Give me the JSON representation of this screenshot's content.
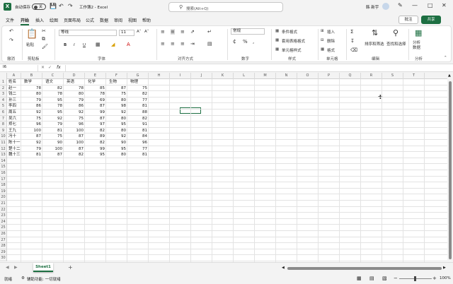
{
  "titlebar": {
    "logo": "X",
    "autosave_label": "自动保存",
    "autosave_state": "关",
    "title": "工作簿2 - Excel",
    "search_placeholder": "搜索(Alt+Q)",
    "user": "韩 新宇",
    "icons": [
      "excel-icon",
      "save-icon",
      "undo-icon",
      "redo-icon",
      "search-icon",
      "pen-icon",
      "minimize-icon",
      "maximize-icon",
      "close-icon"
    ]
  },
  "menu": {
    "items": [
      "文件",
      "开始",
      "插入",
      "绘图",
      "页面布局",
      "公式",
      "数据",
      "审阅",
      "视图",
      "帮助"
    ],
    "active": "开始",
    "comment_label": "批注",
    "share_label": "共享"
  },
  "ribbon": {
    "groups": [
      "撤消",
      "剪贴板",
      "字体",
      "对齐方式",
      "数字",
      "样式",
      "单元格",
      "编辑",
      "分析"
    ],
    "paste_label": "粘贴",
    "font_name": "等线",
    "font_size": "11",
    "number_format": "常规",
    "cond_format": "条件格式",
    "table_format": "套用表格格式",
    "cell_styles": "单元格样式",
    "insert": "插入",
    "delete": "删除",
    "format": "格式",
    "sort_filter": "排序和筛选",
    "find_select": "查找和选择",
    "analyze": "分析\n数据",
    "bold": "B",
    "italic": "I",
    "underline": "U"
  },
  "formula_bar": {
    "name_box": "I6",
    "fx": "fx",
    "content": ""
  },
  "sheet": {
    "columns": [
      "A",
      "B",
      "C",
      "D",
      "E",
      "F",
      "G",
      "H",
      "I",
      "J",
      "K",
      "L",
      "M",
      "N",
      "O",
      "P",
      "Q",
      "R",
      "S",
      "T"
    ],
    "row_numbers": [
      "1",
      "2",
      "3",
      "4",
      "5",
      "6",
      "7",
      "8",
      "9",
      "10",
      "11",
      "12",
      "13",
      "14",
      "15",
      "16",
      "17",
      "18",
      "19",
      "20",
      "21",
      "22",
      "23",
      "24",
      "25",
      "26",
      "27",
      "28",
      "29",
      "30"
    ],
    "rows": [
      [
        "姓名",
        "数学",
        "语文",
        "英语",
        "化学",
        "生物",
        "物理"
      ],
      [
        "赵一",
        "78",
        "82",
        "78",
        "85",
        "87",
        "75"
      ],
      [
        "钱二",
        "80",
        "78",
        "80",
        "78",
        "75",
        "82"
      ],
      [
        "孙三",
        "79",
        "95",
        "79",
        "69",
        "80",
        "77"
      ],
      [
        "李四",
        "86",
        "78",
        "86",
        "87",
        "98",
        "81"
      ],
      [
        "周五",
        "92",
        "95",
        "92",
        "99",
        "92",
        "88"
      ],
      [
        "吴六",
        "75",
        "92",
        "75",
        "87",
        "80",
        "82"
      ],
      [
        "郑七",
        "96",
        "79",
        "96",
        "97",
        "95",
        "91"
      ],
      [
        "王九",
        "100",
        "81",
        "100",
        "82",
        "80",
        "81"
      ],
      [
        "冯十",
        "87",
        "75",
        "87",
        "89",
        "92",
        "84"
      ],
      [
        "陈十一",
        "92",
        "90",
        "100",
        "82",
        "90",
        "96"
      ],
      [
        "楚十二",
        "79",
        "100",
        "87",
        "99",
        "95",
        "77"
      ],
      [
        "魏十三",
        "81",
        "87",
        "82",
        "95",
        "80",
        "81"
      ]
    ]
  },
  "tabs": {
    "sheet": "Sheet1",
    "add": "+"
  },
  "status": {
    "ready": "就绪",
    "accessibility": "辅助功能: 一切就绪",
    "zoom": "100%"
  }
}
